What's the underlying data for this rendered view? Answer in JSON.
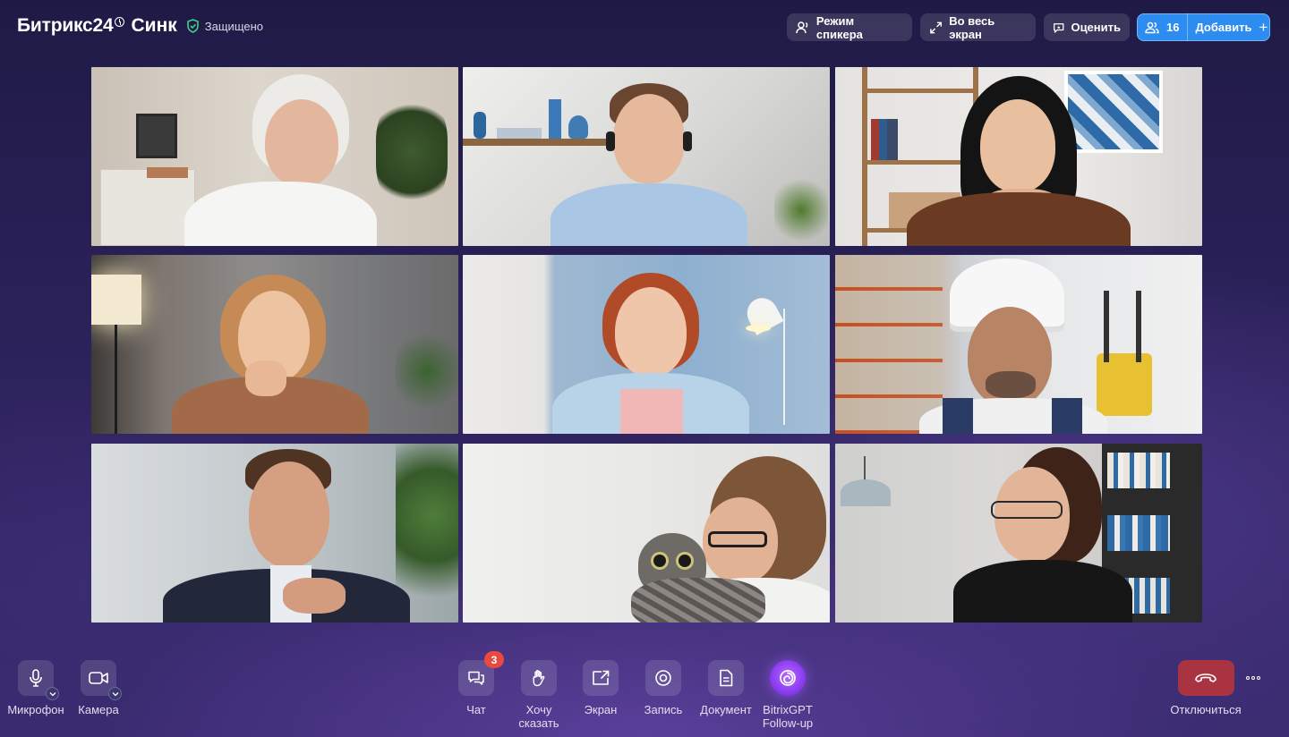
{
  "header": {
    "brand_name": "Битрикс24",
    "brand_product": "Синк",
    "secure_label": "Защищено",
    "speaker_mode": "Режим спикера",
    "fullscreen": "Во весь экран",
    "rate": "Оценить",
    "participants_count": "16",
    "add_label": "Добавить"
  },
  "toolbar": {
    "microphone": "Микрофон",
    "camera": "Камера",
    "chat": "Чат",
    "chat_badge": "3",
    "raise_hand_line1": "Хочу",
    "raise_hand_line2": "сказать",
    "screen": "Экран",
    "record": "Запись",
    "document": "Документ",
    "gpt_line1": "BitrixGPT",
    "gpt_line2": "Follow-up",
    "hangup": "Отключиться"
  },
  "colors": {
    "accent_blue": "#2d8cf0",
    "hangup_red": "#a93340",
    "badge_red": "#e84a3f",
    "secure_green": "#3fd08a",
    "gpt_purple": "#8b3cf0"
  }
}
